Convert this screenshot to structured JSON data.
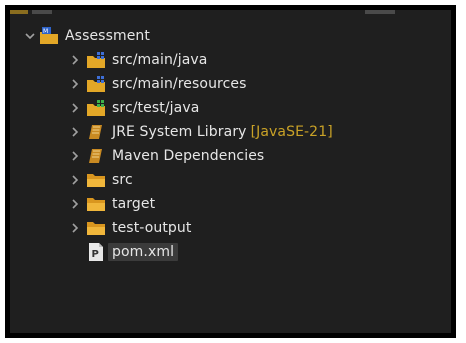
{
  "explorer": {
    "root": {
      "label": "Assessment",
      "icon": "maven-project-icon",
      "expanded": true
    },
    "items": [
      {
        "label": "src/main/java",
        "icon": "source-folder-java-icon",
        "decoration": ""
      },
      {
        "label": "src/main/resources",
        "icon": "source-folder-java-icon",
        "decoration": ""
      },
      {
        "label": "src/test/java",
        "icon": "source-folder-test-icon",
        "decoration": ""
      },
      {
        "label": "JRE System Library",
        "icon": "library-icon",
        "decoration": "[JavaSE-21]"
      },
      {
        "label": "Maven Dependencies",
        "icon": "library-icon",
        "decoration": ""
      },
      {
        "label": "src",
        "icon": "folder-icon",
        "decoration": ""
      },
      {
        "label": "target",
        "icon": "folder-icon",
        "decoration": ""
      },
      {
        "label": "test-output",
        "icon": "folder-icon",
        "decoration": ""
      },
      {
        "label": "pom.xml",
        "icon": "pom-file-icon",
        "decoration": "",
        "selected": true
      }
    ]
  }
}
